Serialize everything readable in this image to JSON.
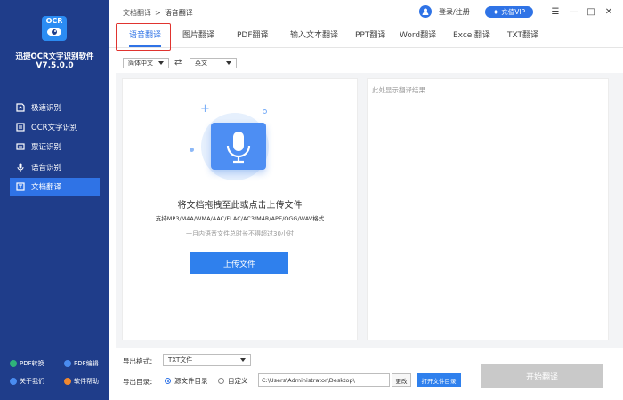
{
  "app": {
    "logo_text": "OCR",
    "name": "迅捷OCR文字识别软件",
    "version": "V7.5.0.0"
  },
  "sidebar": {
    "items": [
      {
        "label": "极速识别",
        "icon": "speed-icon"
      },
      {
        "label": "OCR文字识别",
        "icon": "ocr-icon"
      },
      {
        "label": "票证识别",
        "icon": "ticket-icon"
      },
      {
        "label": "语音识别",
        "icon": "microphone-icon"
      },
      {
        "label": "文档翻译",
        "icon": "translate-icon",
        "active": true
      }
    ],
    "footer": [
      {
        "label": "PDF转换",
        "color": "#2fb37a"
      },
      {
        "label": "PDF编辑",
        "color": "#4a8cf0"
      },
      {
        "label": "关于我们",
        "color": "#4a8cf0"
      },
      {
        "label": "软件帮助",
        "color": "#f0882f"
      }
    ]
  },
  "header": {
    "breadcrumb_root": "文档翻译",
    "breadcrumb_sep": ">",
    "breadcrumb_current": "语音翻译",
    "user_label": "登录/注册",
    "vip_label": "充值VIP",
    "window_controls": [
      "menu-icon",
      "minimize-icon",
      "maximize-icon",
      "close-icon"
    ]
  },
  "tabs": [
    {
      "label": "语音翻译",
      "active": true
    },
    {
      "label": "图片翻译"
    },
    {
      "label": "PDF翻译"
    },
    {
      "label": "输入文本翻译"
    },
    {
      "label": "PPT翻译"
    },
    {
      "label": "Word翻译"
    },
    {
      "label": "Excel翻译"
    },
    {
      "label": "TXT翻译"
    }
  ],
  "language": {
    "source": "简体中文",
    "target": "英文",
    "swap_icon": "swap-icon"
  },
  "upload": {
    "title": "将文档拖拽至此或点击上传文件",
    "formats": "支持MP3/M4A/WMA/AAC/FLAC/AC3/M4R/APE/OGG/WAV格式",
    "limit": "一月内语音文件总时长不得超过30小时",
    "button": "上传文件"
  },
  "result": {
    "placeholder": "此处显示翻译结果"
  },
  "export": {
    "format_label": "导出格式：",
    "format_value": "TXT文件",
    "dir_label": "导出目录：",
    "radio_source": "源文件目录",
    "radio_custom": "自定义",
    "path": "C:\\Users\\Administrator\\Desktop\\",
    "change_label": "更改",
    "open_dir_label": "打开文件目录",
    "start_label": "开始翻译"
  },
  "colors": {
    "sidebar": "#1f3d8a",
    "accent": "#2f73e6",
    "highlight_box": "#e0342f",
    "disabled_button": "#c9c9c9"
  }
}
